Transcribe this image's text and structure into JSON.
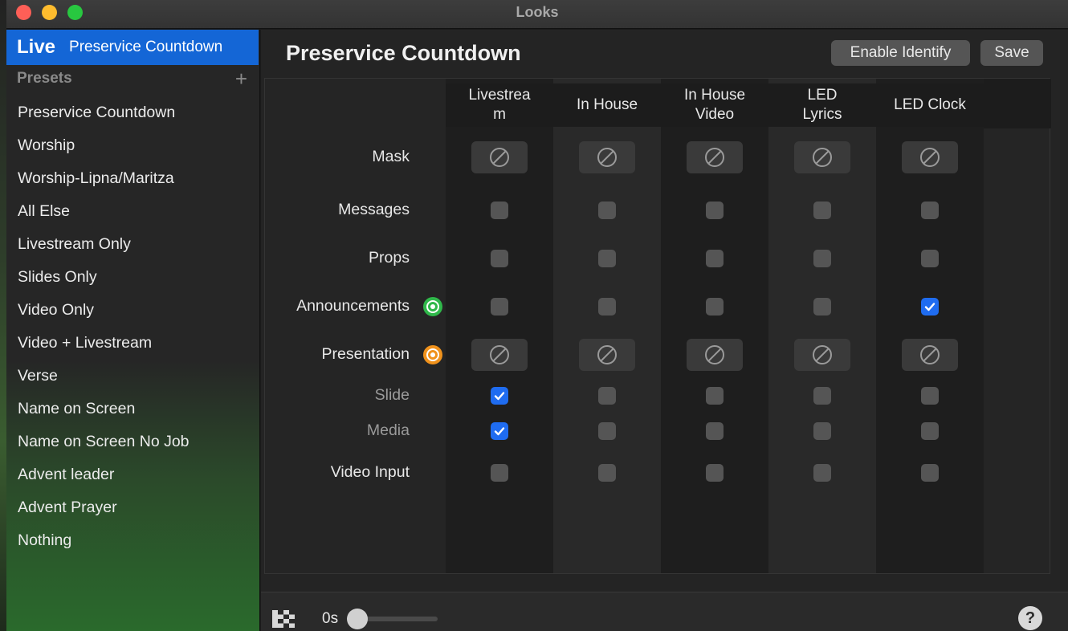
{
  "window": {
    "title": "Looks"
  },
  "sidebar": {
    "live_label": "Live",
    "live_current": "Preservice Countdown",
    "presets_label": "Presets",
    "add_icon": "plus-icon",
    "items": [
      "Preservice Countdown",
      "Worship",
      "Worship-Lipna/Maritza",
      "All Else",
      "Livestream Only",
      "Slides Only",
      "Video Only",
      "Video + Livestream",
      "Verse",
      "Name on Screen",
      "Name on Screen No Job",
      "Advent leader",
      "Advent Prayer",
      "Nothing"
    ]
  },
  "main": {
    "title": "Preservice Countdown",
    "enable_identify_label": "Enable Identify",
    "save_label": "Save",
    "columns": [
      "Livestrea m",
      "In House",
      "In House Video",
      "LED Lyrics",
      "LED Clock"
    ],
    "rows": [
      {
        "label": "Mask",
        "type": "none",
        "values": [
          false,
          false,
          false,
          false,
          false
        ]
      },
      {
        "label": "Messages",
        "type": "check",
        "values": [
          false,
          false,
          false,
          false,
          false
        ]
      },
      {
        "label": "Props",
        "type": "check",
        "values": [
          false,
          false,
          false,
          false,
          false
        ]
      },
      {
        "label": "Announcements",
        "type": "check",
        "indicator": "green",
        "values": [
          false,
          false,
          false,
          false,
          true
        ]
      },
      {
        "label": "Presentation",
        "type": "none",
        "indicator": "orange",
        "values": [
          false,
          false,
          false,
          false,
          false
        ]
      },
      {
        "label": "Slide",
        "type": "check",
        "sub": true,
        "values": [
          true,
          false,
          false,
          false,
          false
        ]
      },
      {
        "label": "Media",
        "type": "check",
        "sub": true,
        "values": [
          true,
          false,
          false,
          false,
          false
        ]
      },
      {
        "label": "Video Input",
        "type": "check",
        "values": [
          false,
          false,
          false,
          false,
          false
        ]
      }
    ]
  },
  "bottom": {
    "transition_icon": "checkerboard-icon",
    "duration_label": "0s",
    "duration_value": 0,
    "help_label": "?"
  },
  "colors": {
    "accent": "#1466d6",
    "checkbox_on": "#1f6cf0",
    "green_indicator": "#2fb84a",
    "orange_indicator": "#f0921c"
  }
}
